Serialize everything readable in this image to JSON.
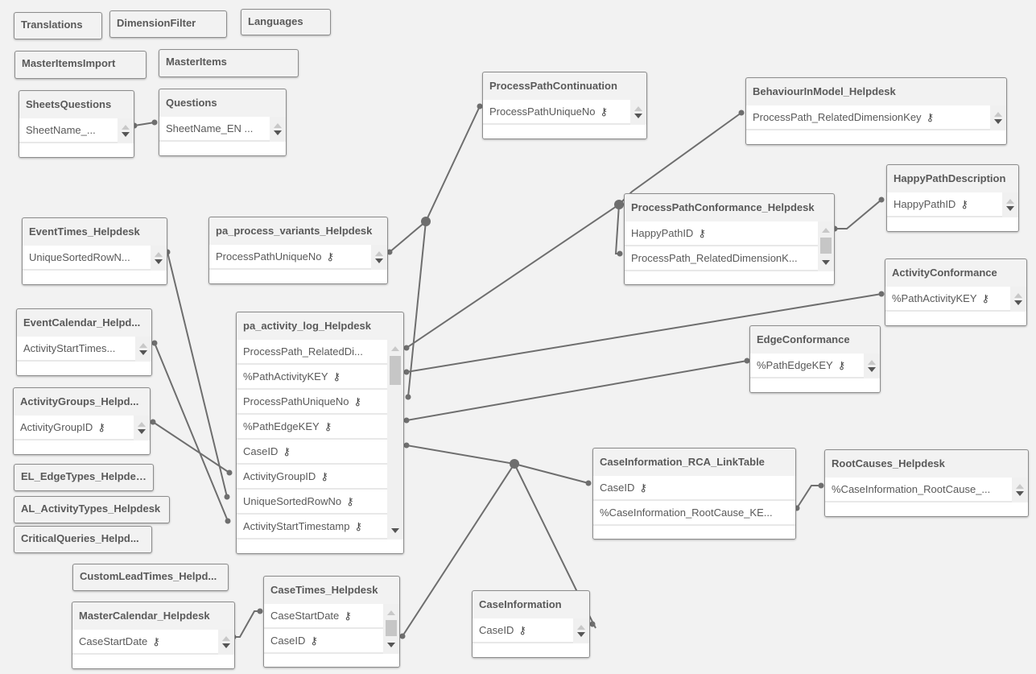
{
  "canvas": {
    "background": "#f2f2f2",
    "line_color": "#6e6e6e",
    "key_icon": "key-icon"
  },
  "tables": [
    {
      "id": "translations",
      "name": "Translations",
      "fields": []
    },
    {
      "id": "dimensionfilter",
      "name": "DimensionFilter",
      "fields": []
    },
    {
      "id": "languages",
      "name": "Languages",
      "fields": []
    },
    {
      "id": "masteritemsimport",
      "name": "MasterItemsImport",
      "fields": []
    },
    {
      "id": "masteritems",
      "name": "MasterItems",
      "fields": []
    },
    {
      "id": "sheetsquestions",
      "name": "SheetsQuestions",
      "fields": [
        {
          "name": "SheetName_...",
          "key": false
        }
      ]
    },
    {
      "id": "questions",
      "name": "Questions",
      "fields": [
        {
          "name": "SheetName_EN ...",
          "key": false
        }
      ]
    },
    {
      "id": "processpathcontinuation",
      "name": "ProcessPathContinuation",
      "fields": [
        {
          "name": "ProcessPathUniqueNo",
          "key": true
        }
      ]
    },
    {
      "id": "behaviourinmodel",
      "name": "BehaviourInModel_Helpdesk",
      "fields": [
        {
          "name": "ProcessPath_RelatedDimensionKey",
          "key": true
        }
      ]
    },
    {
      "id": "happypathdescription",
      "name": "HappyPathDescription",
      "fields": [
        {
          "name": "HappyPathID",
          "key": true
        }
      ]
    },
    {
      "id": "processpathconformance",
      "name": "ProcessPathConformance_Helpdesk",
      "fields": [
        {
          "name": "HappyPathID",
          "key": true
        },
        {
          "name": "ProcessPath_RelatedDimensionK...",
          "key": false
        }
      ]
    },
    {
      "id": "activityconformance",
      "name": "ActivityConformance",
      "fields": [
        {
          "name": "%PathActivityKEY",
          "key": true
        }
      ]
    },
    {
      "id": "edgeconformance",
      "name": "EdgeConformance",
      "fields": [
        {
          "name": "%PathEdgeKEY",
          "key": true
        }
      ]
    },
    {
      "id": "eventtimes",
      "name": "EventTimes_Helpdesk",
      "fields": [
        {
          "name": "UniqueSortedRowN...",
          "key": false
        }
      ]
    },
    {
      "id": "processvariants",
      "name": "pa_process_variants_Helpdesk",
      "fields": [
        {
          "name": "ProcessPathUniqueNo",
          "key": true
        }
      ]
    },
    {
      "id": "eventcalendar",
      "name": "EventCalendar_Helpd...",
      "fields": [
        {
          "name": "ActivityStartTimes...",
          "key": false
        }
      ]
    },
    {
      "id": "activitylog",
      "name": "pa_activity_log_Helpdesk",
      "fields": [
        {
          "name": "ProcessPath_RelatedDi...",
          "key": false
        },
        {
          "name": "%PathActivityKEY",
          "key": true
        },
        {
          "name": "ProcessPathUniqueNo",
          "key": true
        },
        {
          "name": "%PathEdgeKEY",
          "key": true
        },
        {
          "name": "CaseID",
          "key": true
        },
        {
          "name": "ActivityGroupID",
          "key": true
        },
        {
          "name": "UniqueSortedRowNo",
          "key": true
        },
        {
          "name": "ActivityStartTimestamp",
          "key": true
        }
      ]
    },
    {
      "id": "activitygroups",
      "name": "ActivityGroups_Helpd...",
      "fields": [
        {
          "name": "ActivityGroupID",
          "key": true
        }
      ]
    },
    {
      "id": "edgetypes",
      "name": "EL_EdgeTypes_Helpdesk",
      "fields": []
    },
    {
      "id": "activitytypes",
      "name": "AL_ActivityTypes_Helpdesk",
      "fields": []
    },
    {
      "id": "criticalqueries",
      "name": "CriticalQueries_Helpd...",
      "fields": []
    },
    {
      "id": "customleadtimes",
      "name": "CustomLeadTimes_Helpd...",
      "fields": []
    },
    {
      "id": "mastercalendar",
      "name": "MasterCalendar_Helpdesk",
      "fields": [
        {
          "name": "CaseStartDate",
          "key": true
        }
      ]
    },
    {
      "id": "casetimes",
      "name": "CaseTimes_Helpdesk",
      "fields": [
        {
          "name": "CaseStartDate",
          "key": true
        },
        {
          "name": "CaseID",
          "key": true
        }
      ]
    },
    {
      "id": "caseinformation",
      "name": "CaseInformation",
      "fields": [
        {
          "name": "CaseID",
          "key": true
        }
      ]
    },
    {
      "id": "rcalinktable",
      "name": "CaseInformation_RCA_LinkTable",
      "fields": [
        {
          "name": "CaseID",
          "key": true
        },
        {
          "name": "%CaseInformation_RootCause_KE...",
          "key": false
        }
      ]
    },
    {
      "id": "rootcauses",
      "name": "RootCauses_Helpdesk",
      "fields": [
        {
          "name": "%CaseInformation_RootCause_...",
          "key": false
        }
      ]
    }
  ]
}
